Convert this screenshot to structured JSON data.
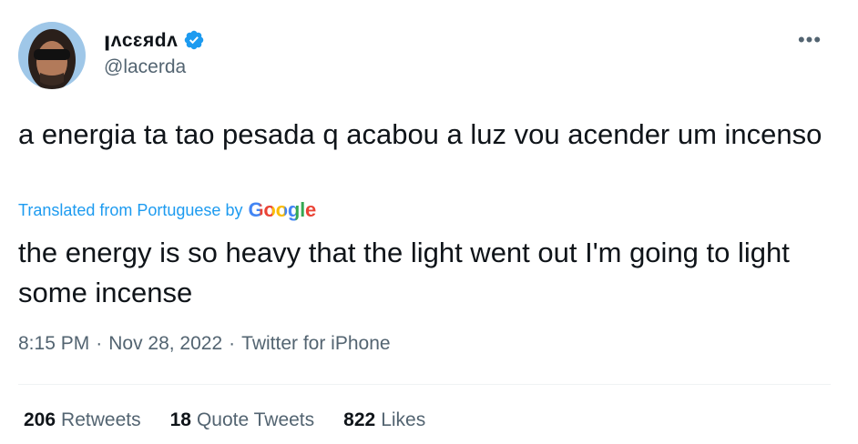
{
  "author": {
    "display_name": "ꞁᴧᴄɛᴙdᴧ",
    "handle": "@lacerda",
    "verified_badge": "verified-badge-icon"
  },
  "menu": {
    "more_label": "•••"
  },
  "tweet": {
    "text": "a energia ta tao pesada q acabou a luz vou acender um incenso",
    "translation_notice": "Translated from Portuguese by",
    "translation_provider": "Google",
    "translation": "the energy is so heavy that the light went out I'm going to light some incense"
  },
  "meta": {
    "time": "8:15 PM",
    "separator": "·",
    "date": "Nov 28, 2022",
    "source": "Twitter for iPhone"
  },
  "stats": {
    "retweets_count": "206",
    "retweets_label": "Retweets",
    "quotes_count": "18",
    "quotes_label": "Quote Tweets",
    "likes_count": "822",
    "likes_label": "Likes"
  },
  "colors": {
    "accent": "#1d9bf0",
    "text_primary": "#0f1419",
    "text_secondary": "#536471",
    "divider": "#eff3f4"
  }
}
